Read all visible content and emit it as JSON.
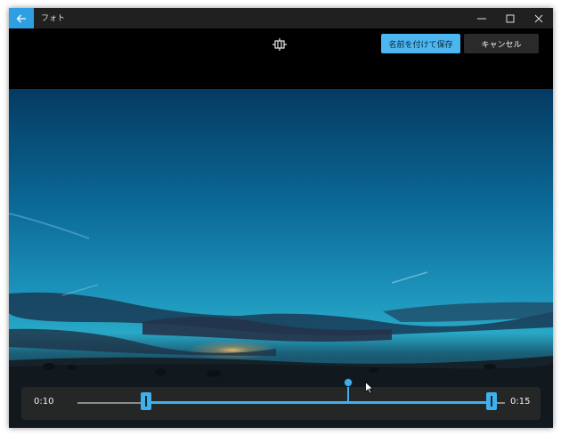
{
  "app": {
    "title": "フォト"
  },
  "window_controls": {
    "minimize": "minimize-icon",
    "maximize": "maximize-icon",
    "close": "close-icon"
  },
  "toolbar": {
    "trim_icon": "trim-icon",
    "save_as_label": "名前を付けて保存",
    "cancel_label": "キャンセル"
  },
  "colors": {
    "accent": "#4cb6f0",
    "titlebar": "#202020",
    "background": "#000000"
  },
  "player": {
    "start_time": "0:10",
    "end_time": "0:15"
  }
}
